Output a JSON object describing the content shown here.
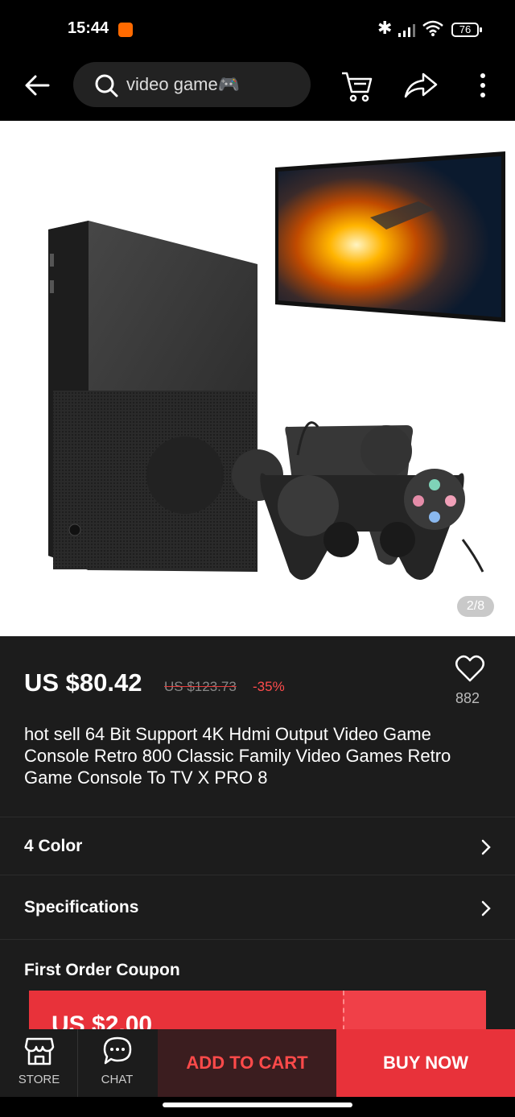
{
  "status_bar": {
    "time": "15:44",
    "battery": "76"
  },
  "header": {
    "search_text": "video game🎮",
    "icons": [
      "back-arrow-icon",
      "search-icon",
      "cart-icon",
      "share-icon",
      "more-icon"
    ]
  },
  "gallery": {
    "counter": "2/8"
  },
  "product": {
    "price": "US $80.42",
    "original_price": "US $123.73",
    "discount": "-35%",
    "wishlist_count": "882",
    "title": "hot sell 64 Bit Support 4K Hdmi Output Video Game Console Retro 800 Classic Family Video Games Retro Game Console To TV X PRO 8"
  },
  "options": [
    {
      "label": "4 Color"
    },
    {
      "label": "Specifications"
    }
  ],
  "coupon": {
    "section_title": "First Order Coupon",
    "amount": "US $2.00"
  },
  "bottom_bar": {
    "store_label": "STORE",
    "chat_label": "CHAT",
    "add_to_cart": "ADD TO CART",
    "buy_now": "BUY NOW"
  },
  "colors": {
    "accent": "#e8323a",
    "background": "#1c1c1c"
  }
}
